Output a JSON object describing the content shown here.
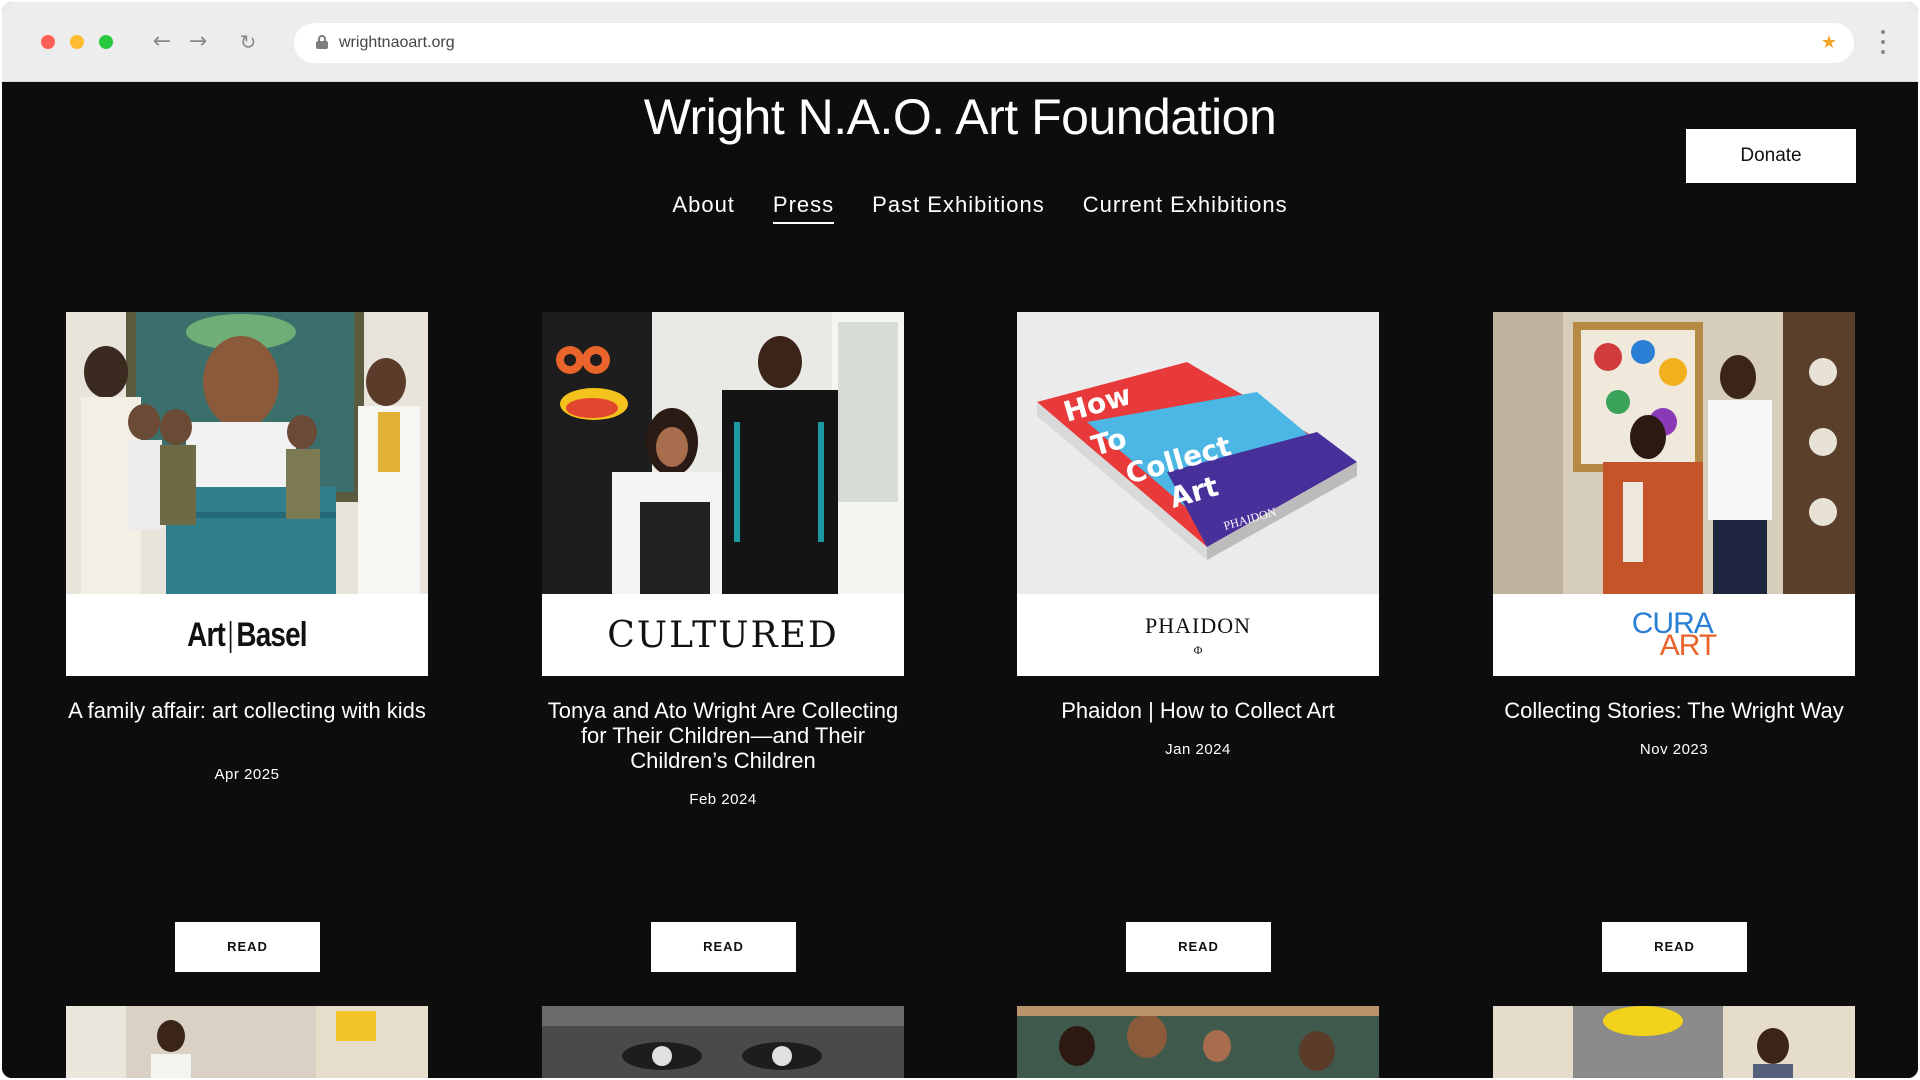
{
  "browser": {
    "url": "wrightnaoart.org",
    "icons": {
      "back": "arrow-left-icon",
      "forward": "arrow-right-icon",
      "reload": "reload-icon",
      "lock": "lock-icon",
      "bookmark": "star-icon",
      "menu": "kebab-menu-icon"
    },
    "colors": {
      "close": "#ff5f57",
      "minimize": "#febc2e",
      "maximize": "#28c840",
      "star": "#f4a52a"
    }
  },
  "site": {
    "title": "Wright N.A.O. Art Foundation",
    "donate_label": "Donate",
    "nav": [
      {
        "label": "About"
      },
      {
        "label": "Press",
        "active": true
      },
      {
        "label": "Past Exhibitions"
      },
      {
        "label": "Current Exhibitions"
      }
    ]
  },
  "press": [
    {
      "logo": "Art|Basel",
      "logo_parts": [
        "Art",
        "Basel"
      ],
      "title": "A family affair: art collecting with kids",
      "date": "Apr 2025",
      "read_label": "READ"
    },
    {
      "logo": "CULTURED",
      "title": "Tonya and Ato Wright Are Collecting for Their Children—and Their Children’s Children",
      "date": "Feb 2024",
      "read_label": "READ"
    },
    {
      "logo": "PHAIDON",
      "logo_mark": "Φ",
      "book_lines": [
        "How",
        "To",
        "Collect",
        "Art"
      ],
      "book_publisher": "PHAIDON",
      "title": "Phaidon | How to Collect Art",
      "date": "Jan 2024",
      "read_label": "READ"
    },
    {
      "logo_lines": [
        "CURA",
        "ART"
      ],
      "title": "Collecting Stories: The Wright Way",
      "date": "Nov 2023",
      "read_label": "READ"
    }
  ]
}
